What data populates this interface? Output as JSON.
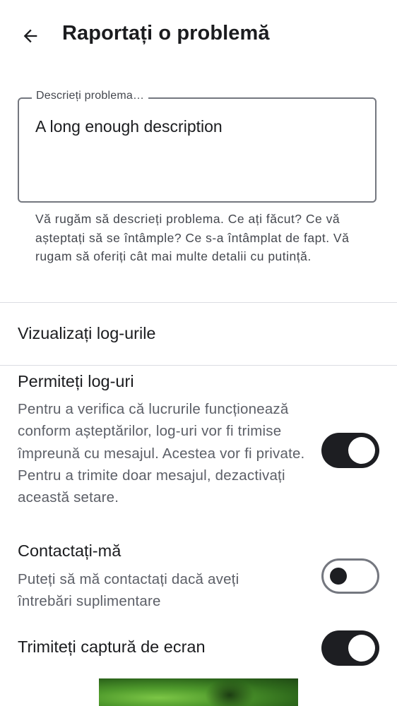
{
  "header": {
    "title": "Raportați o problemă",
    "back_icon": "arrow-left-icon"
  },
  "description": {
    "label": "Descrieți problema…",
    "value": "A long enough description",
    "helper": "Vă rugăm să descrieți problema. Ce ați făcut? Ce vă așteptați să se întâmple? Ce s-a întâmplat de fapt. Vă rugam să oferiți cât mai multe detalii cu putință."
  },
  "view_logs": {
    "label": "Vizualizați log-urile"
  },
  "allow_logs": {
    "title": "Permiteți log-uri",
    "description": "Pentru a verifica că lucrurile funcționează conform așteptărilor, log-uri vor fi trimise împreună cu mesajul. Acestea vor fi private. Pentru a trimite doar mesajul, dezactivați această setare.",
    "enabled": true
  },
  "contact_me": {
    "title": "Contactați-mă",
    "description": "Puteți să mă contactați dacă aveți întrebări suplimentare",
    "enabled": false
  },
  "send_screenshot": {
    "title": "Trimiteți captură de ecran",
    "enabled": true
  },
  "colors": {
    "text": "#1b1c1f",
    "secondary_text": "#5c5f67",
    "switch_on": "#1d1e22",
    "outline": "#74777f"
  }
}
